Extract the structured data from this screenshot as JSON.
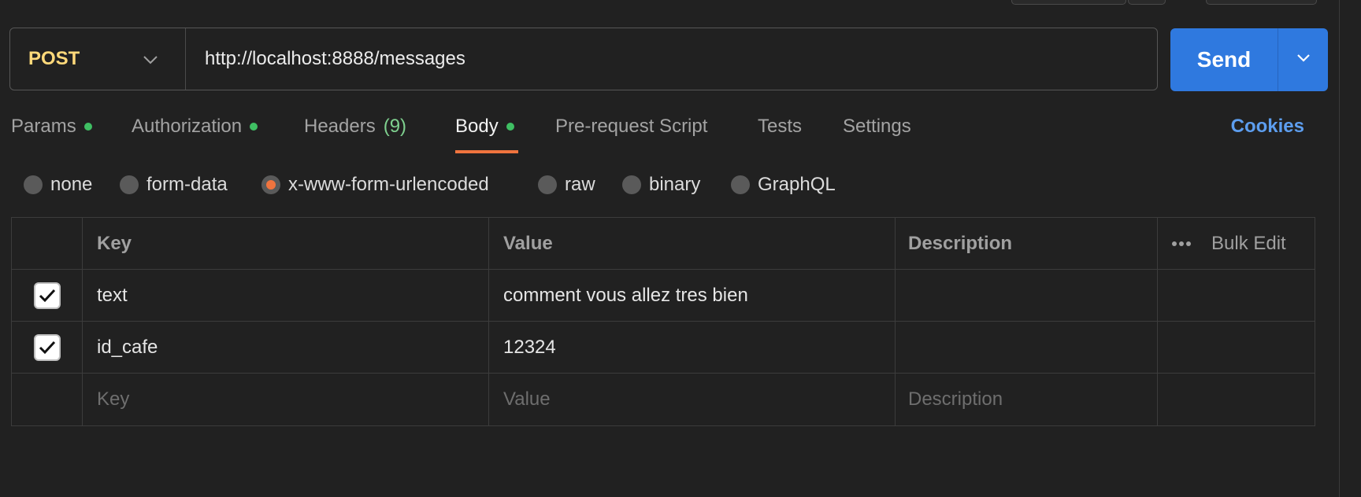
{
  "request": {
    "method": "POST",
    "url": "http://localhost:8888/messages"
  },
  "send": {
    "label": "Send"
  },
  "tabs": [
    {
      "label": "Params",
      "dot": true
    },
    {
      "label": "Authorization",
      "dot": true
    },
    {
      "label": "Headers",
      "count": "(9)"
    },
    {
      "label": "Body",
      "dot": true,
      "active": true
    },
    {
      "label": "Pre-request Script"
    },
    {
      "label": "Tests"
    },
    {
      "label": "Settings"
    }
  ],
  "cookies_label": "Cookies",
  "body_types": [
    "none",
    "form-data",
    "x-www-form-urlencoded",
    "raw",
    "binary",
    "GraphQL"
  ],
  "body_type_selected": "x-www-form-urlencoded",
  "table": {
    "headers": {
      "key": "Key",
      "value": "Value",
      "description": "Description",
      "bulk_edit": "Bulk Edit"
    },
    "rows": [
      {
        "checked": true,
        "key": "text",
        "value": "comment vous allez tres bien",
        "description": ""
      },
      {
        "checked": true,
        "key": "id_cafe",
        "value": "12324",
        "description": ""
      }
    ],
    "placeholder": {
      "key": "Key",
      "value": "Value",
      "description": "Description"
    }
  },
  "colors": {
    "accent": "#2f79df",
    "method": "#ffd97a",
    "active_tab_underline": "#f0743e",
    "status_dot": "#3fbf63",
    "cookies": "#5d9eef"
  }
}
